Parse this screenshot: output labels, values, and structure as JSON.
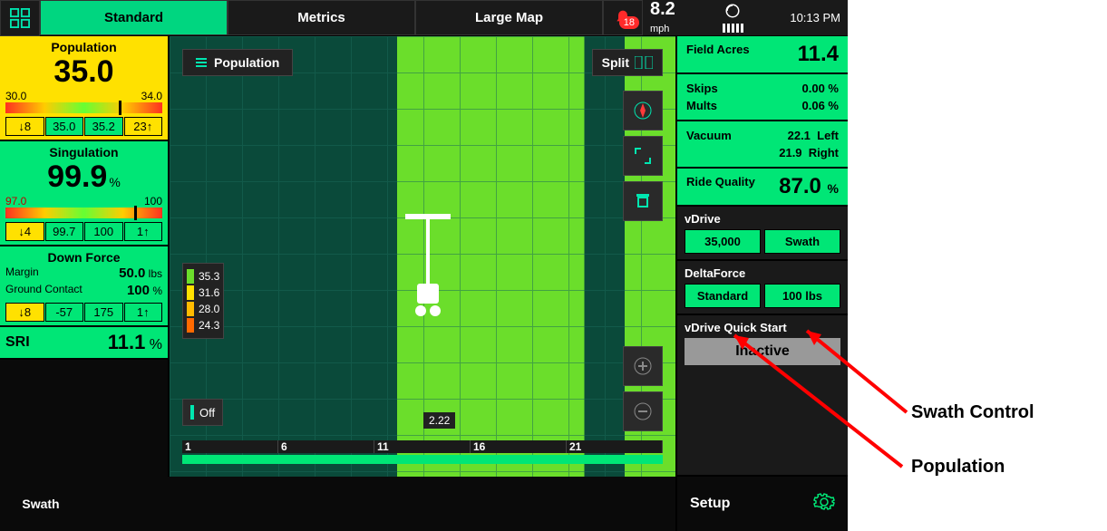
{
  "tabs": {
    "standard": "Standard",
    "metrics": "Metrics",
    "largemap": "Large Map"
  },
  "alert_count": "18",
  "speed": {
    "value": "8.2",
    "unit": "mph"
  },
  "time": "10:13 PM",
  "population": {
    "title": "Population",
    "value": "35.0",
    "low": "30.0",
    "high": "34.0",
    "row": {
      "d": "↓8",
      "v1": "35.0",
      "v2": "35.2",
      "u": "23↑"
    }
  },
  "singulation": {
    "title": "Singulation",
    "value": "99.9",
    "unit": "%",
    "low": "97.0",
    "high": "100",
    "row": {
      "d": "↓4",
      "v1": "99.7",
      "v2": "100",
      "u": "1↑"
    }
  },
  "downforce": {
    "title": "Down Force",
    "margin_label": "Margin",
    "margin_val": "50.0",
    "margin_unit": "lbs",
    "gc_label": "Ground Contact",
    "gc_val": "100",
    "gc_unit": "%",
    "row": {
      "d": "↓8",
      "v1": "-57",
      "v2": "175",
      "u": "1↑"
    }
  },
  "sri": {
    "label": "SRI",
    "value": "11.1",
    "unit": "%"
  },
  "map": {
    "overlay": "Population",
    "split": "Split",
    "ruler_val": "2.22",
    "legend": [
      {
        "c": "#6bde2b",
        "v": "35.3"
      },
      {
        "c": "#ffe100",
        "v": "31.6"
      },
      {
        "c": "#ffbb00",
        "v": "28.0"
      },
      {
        "c": "#ff6a00",
        "v": "24.3"
      }
    ],
    "off": "Off",
    "ticks": [
      "1",
      "6",
      "11",
      "16",
      "21"
    ]
  },
  "info": {
    "field_acres_label": "Field Acres",
    "field_acres": "11.4",
    "skips_label": "Skips",
    "skips": "0.00 %",
    "mults_label": "Mults",
    "mults": "0.06 %",
    "vacuum_label": "Vacuum",
    "vac_left": "22.1",
    "vac_left_l": "Left",
    "vac_right": "21.9",
    "vac_right_l": "Right",
    "ride_label": "Ride Quality",
    "ride_val": "87.0",
    "ride_unit": "%"
  },
  "vdrive": {
    "title": "vDrive",
    "pop": "35,000",
    "swath": "Swath"
  },
  "delta": {
    "title": "DeltaForce",
    "std": "Standard",
    "lbs": "100 lbs"
  },
  "quick": {
    "title": "vDrive Quick Start",
    "state": "Inactive"
  },
  "footer": {
    "swath": "Swath",
    "setup": "Setup"
  },
  "annotations": {
    "swath": "Swath Control",
    "pop": "Population"
  }
}
